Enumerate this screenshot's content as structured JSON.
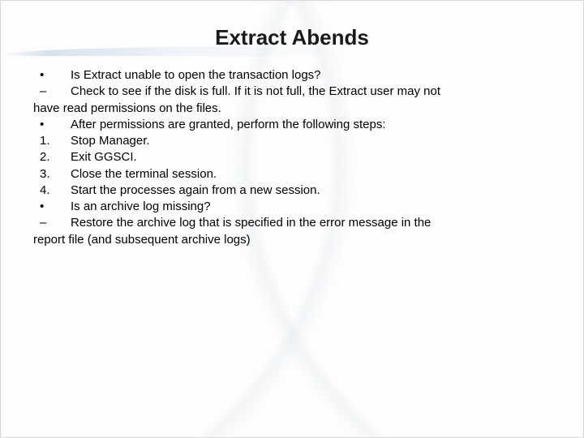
{
  "title": "Extract Abends",
  "lines": [
    {
      "marker": "•",
      "text": "Is Extract unable to open the transaction logs?"
    },
    {
      "marker": "–",
      "text": "Check to see if the disk is full. If it is not full, the Extract user may not"
    },
    {
      "marker": "",
      "text": "have read permissions on the files.",
      "wrap": true
    },
    {
      "marker": "•",
      "text": "After permissions are granted, perform the following steps:"
    },
    {
      "marker": "1.",
      "text": "Stop Manager."
    },
    {
      "marker": "2.",
      "text": "Exit GGSCI."
    },
    {
      "marker": "3.",
      "text": "Close the terminal session."
    },
    {
      "marker": "4.",
      "text": "Start the processes again from a new session."
    },
    {
      "marker": "•",
      "text": "Is an archive log missing?"
    },
    {
      "marker": "–",
      "text": "Restore the archive log that is specified in the error message in the"
    },
    {
      "marker": "",
      "text": "report file (and subsequent archive logs)",
      "wrap": true
    }
  ]
}
